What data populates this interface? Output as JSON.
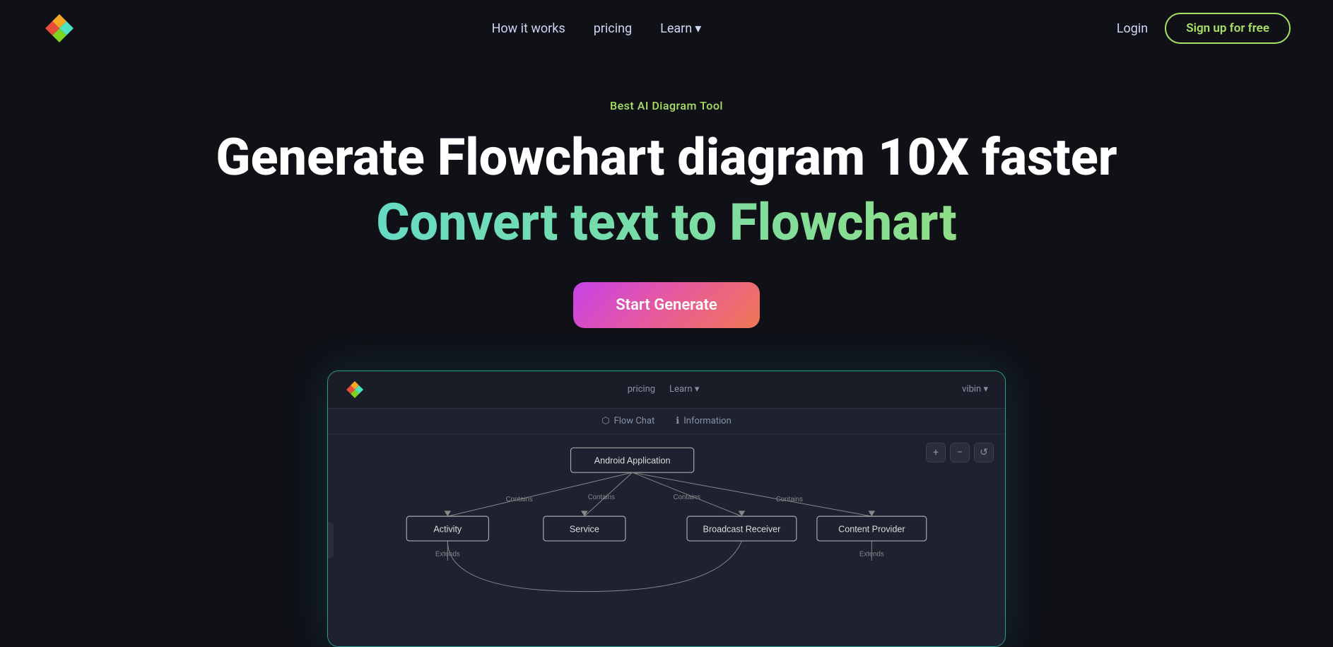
{
  "nav": {
    "links": [
      {
        "label": "How it works",
        "id": "how-it-works"
      },
      {
        "label": "pricing",
        "id": "pricing"
      },
      {
        "label": "Learn",
        "id": "learn"
      }
    ],
    "login_label": "Login",
    "signup_label": "Sign up for free"
  },
  "hero": {
    "badge": "Best AI Diagram Tool",
    "title": "Generate Flowchart diagram 10X faster",
    "subtitle": "Convert text to Flowchart",
    "cta_label": "Start Generate"
  },
  "app_preview": {
    "nav_pricing": "pricing",
    "nav_learn": "Learn",
    "nav_user": "vibin",
    "tab_flow_chat": "Flow Chat",
    "tab_information": "Information",
    "nodes": {
      "root": "Android Application",
      "children": [
        "Activity",
        "Service",
        "Broadcast Receiver",
        "Content Provider"
      ],
      "edge_labels": [
        "Contains",
        "Contains",
        "Contains",
        "Contains"
      ],
      "sub_labels": [
        "Extends",
        "Extends"
      ]
    }
  },
  "colors": {
    "accent_green": "#a8e063",
    "accent_cyan": "#4dd9e8",
    "accent_purple": "#c742e8",
    "nav_border": "#2a9d8f",
    "bg_dark": "#0f1117",
    "bg_card": "#1a1d28"
  }
}
